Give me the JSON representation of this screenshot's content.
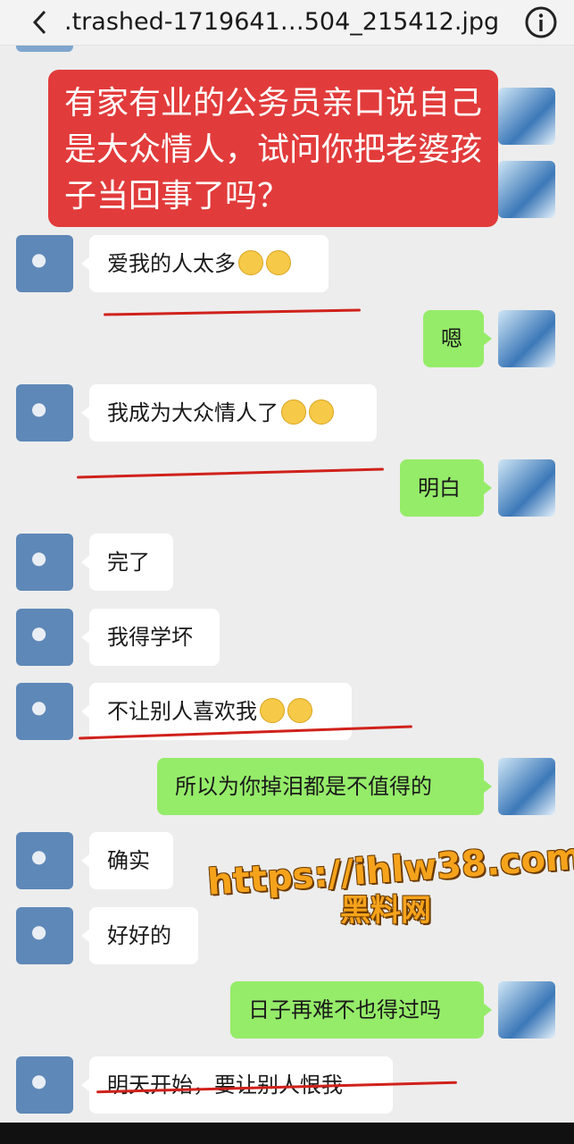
{
  "header": {
    "filename": ".trashed-1719641…504_215412.jpg",
    "back_icon": "chevron-left-icon",
    "info_icon": "info-icon"
  },
  "banner": {
    "text": "有家有业的公务员亲口说自己是大众情人，试问你把老婆孩子当回事了吗？"
  },
  "messages": [
    {
      "side": "left",
      "text": "爱我的人太多",
      "emoji": "thinking-face-emoji"
    },
    {
      "side": "right",
      "text": "嗯"
    },
    {
      "side": "left",
      "text": "我成为大众情人了",
      "emoji": "grinning-face-emoji"
    },
    {
      "side": "right",
      "text": "明白"
    },
    {
      "side": "left",
      "text": "完了"
    },
    {
      "side": "left",
      "text": "我得学坏"
    },
    {
      "side": "left",
      "text": "不让别人喜欢我",
      "emoji": "thinking-face-emoji"
    },
    {
      "side": "right",
      "text": "所以为你掉泪都是不值得的"
    },
    {
      "side": "left",
      "text": "确实"
    },
    {
      "side": "left",
      "text": "好好的"
    },
    {
      "side": "right",
      "text": "日子再难不也得过吗"
    },
    {
      "side": "left",
      "text": "明天开始，要让别人恨我"
    }
  ],
  "watermark": {
    "url": "https://ihlw38.com",
    "label": "黑料网"
  },
  "colors": {
    "my_bubble": "#95ec69",
    "their_bubble": "#ffffff",
    "banner": "#e23b3b",
    "annotation": "#d0211b"
  }
}
